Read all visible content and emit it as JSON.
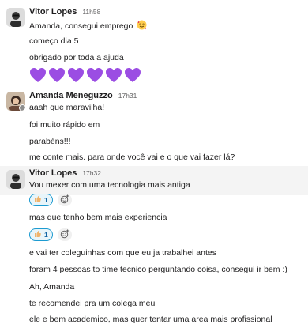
{
  "messages": [
    {
      "author": "Vitor Lopes",
      "time": "11h58",
      "lines": [
        "Amanda, consegui emprego",
        "começo dia 5",
        "obrigado por toda a ajuda"
      ],
      "inline_emoji": "smiling-face-with-hearts",
      "hearts_count": 6,
      "heart_color": "#9b4de3"
    },
    {
      "author": "Amanda Meneguzzo",
      "time": "17h31",
      "lines": [
        "aaah que maravilha!",
        "foi muito rápido em",
        "parabéns!!!",
        "me conte mais. para onde você vai e o que vai fazer lá?"
      ]
    },
    {
      "author": "Vitor Lopes",
      "time": "17h32",
      "lines": [
        "Vou mexer com uma tecnologia mais antiga",
        "mas que tenho bem mais experiencia",
        "e vai ter coleguinhas com que eu ja trabalhei antes",
        "foram 4 pessoas to time tecnico perguntando coisa, consegui ir bem :)",
        "Ah, Amanda",
        "te recomendei pra um colega meu",
        "ele e bem academico, mas quer tentar uma area mais profissional"
      ],
      "reactions": [
        {
          "emoji": "thumbs-up",
          "count": "1"
        },
        {
          "emoji": "thumbs-up",
          "count": "1"
        }
      ]
    }
  ],
  "colors": {
    "reaction_border": "#1d9bd1",
    "reaction_bg": "#e8f5fa",
    "highlight_bg": "#f4f4f4"
  }
}
